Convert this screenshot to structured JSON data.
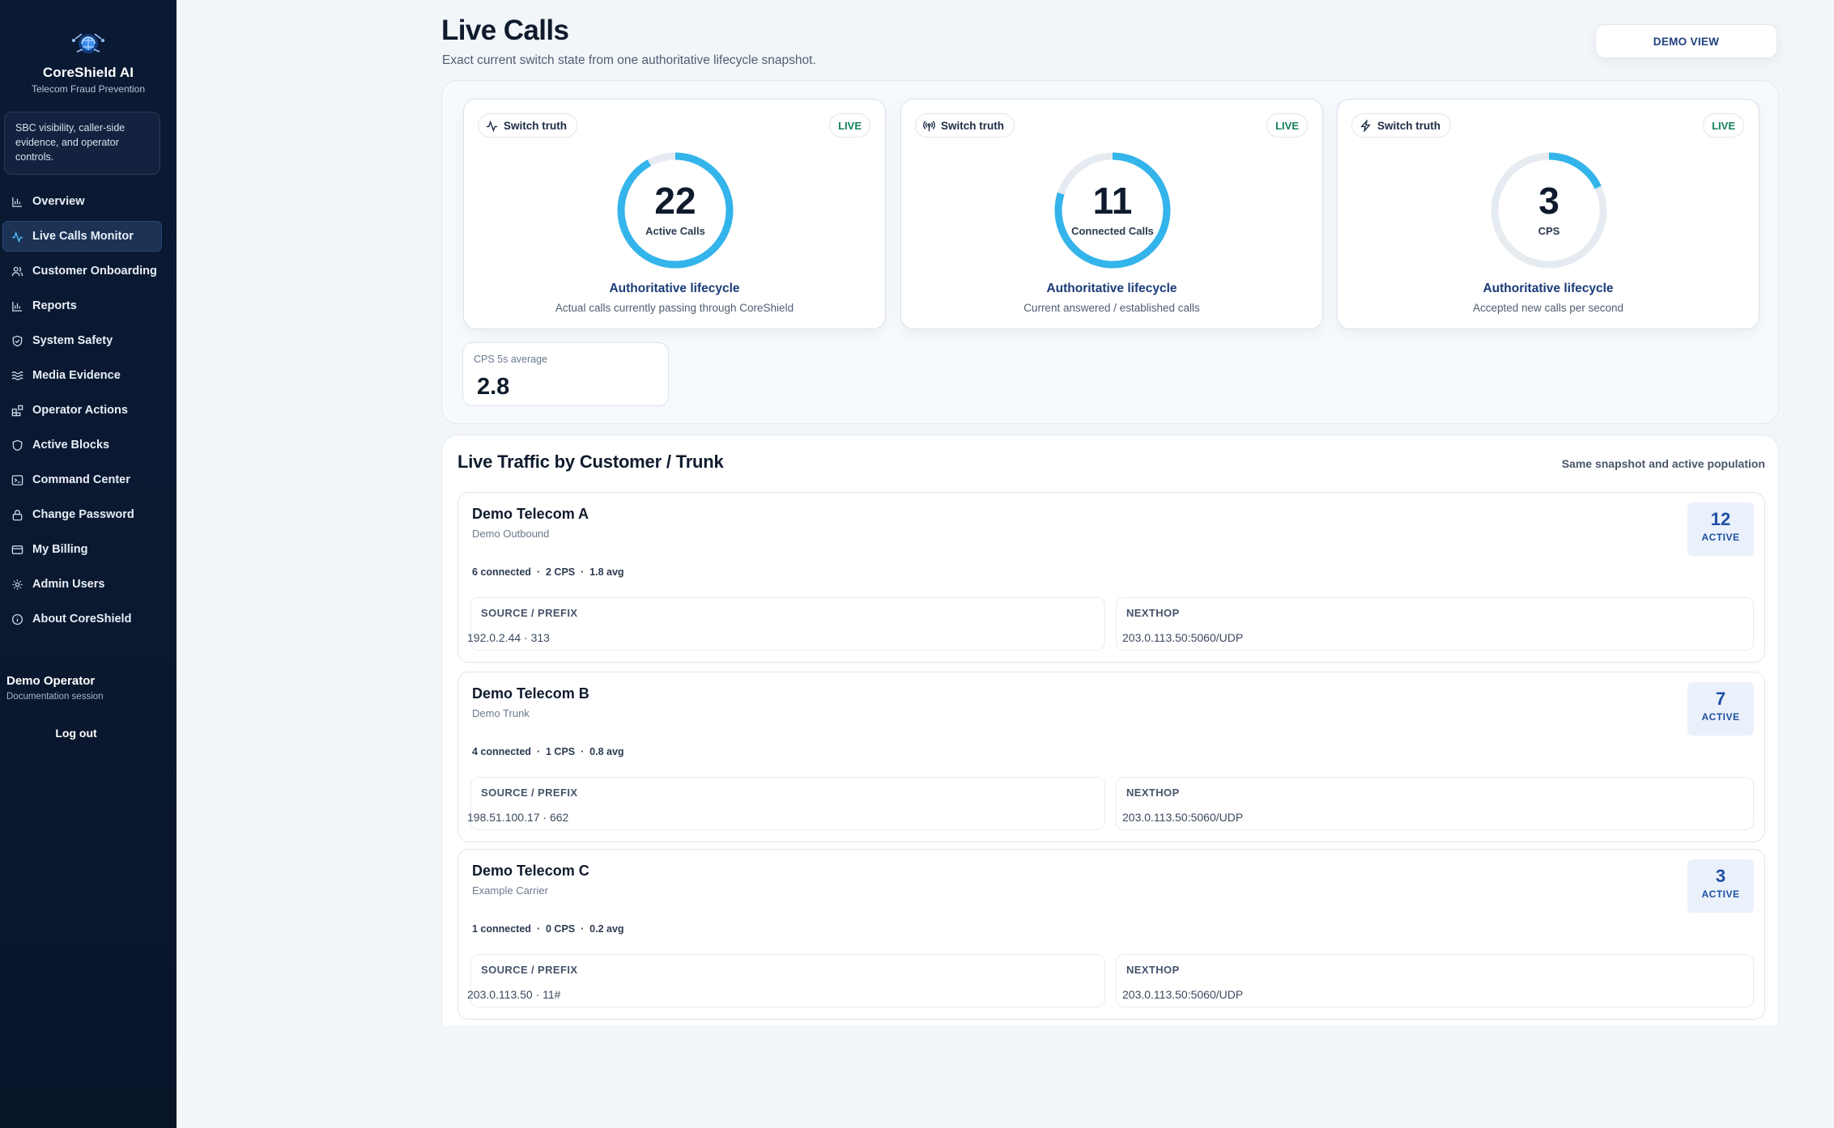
{
  "brand": {
    "name": "CoreShield AI",
    "subtitle": "Telecom Fraud Prevention",
    "tagline": "SBC visibility, caller-side evidence, and operator controls."
  },
  "sidebar": {
    "items": [
      {
        "label": "Overview",
        "icon": "bar-chart-icon"
      },
      {
        "label": "Live Calls Monitor",
        "icon": "activity-icon",
        "active": true
      },
      {
        "label": "Customer Onboarding",
        "icon": "users-icon"
      },
      {
        "label": "Reports",
        "icon": "bar-chart-icon"
      },
      {
        "label": "System Safety",
        "icon": "shield-check-icon"
      },
      {
        "label": "Media Evidence",
        "icon": "waves-icon"
      },
      {
        "label": "Operator Actions",
        "icon": "blocks-icon"
      },
      {
        "label": "Active Blocks",
        "icon": "shield-icon"
      },
      {
        "label": "Command Center",
        "icon": "terminal-icon"
      },
      {
        "label": "Change Password",
        "icon": "lock-icon"
      },
      {
        "label": "My Billing",
        "icon": "card-icon"
      },
      {
        "label": "Admin Users",
        "icon": "gear-icon"
      },
      {
        "label": "About CoreShield",
        "icon": "info-icon"
      }
    ]
  },
  "user": {
    "name": "Demo Operator",
    "role": "Documentation session",
    "logout_label": "Log out"
  },
  "header": {
    "title": "Live Calls",
    "subtitle": "Exact current switch state from one authoritative lifecycle snapshot.",
    "demo_button": "DEMO VIEW"
  },
  "metrics": [
    {
      "chip": "Switch truth",
      "chip_icon": "activity-icon",
      "badge": "LIVE",
      "value": "22",
      "label": "Active Calls",
      "fill": 0.92,
      "title": "Authoritative lifecycle",
      "desc": "Actual calls currently passing through CoreShield"
    },
    {
      "chip": "Switch truth",
      "chip_icon": "antenna-icon",
      "badge": "LIVE",
      "value": "11",
      "label": "Connected Calls",
      "fill": 0.8,
      "title": "Authoritative lifecycle",
      "desc": "Current answered / established calls"
    },
    {
      "chip": "Switch truth",
      "chip_icon": "bolt-icon",
      "badge": "LIVE",
      "value": "3",
      "label": "CPS",
      "fill": 0.18,
      "title": "Authoritative lifecycle",
      "desc": "Accepted new calls per second"
    }
  ],
  "cps_avg": {
    "label": "CPS 5s average",
    "value": "2.8"
  },
  "traffic": {
    "title": "Live Traffic by Customer / Trunk",
    "note": "Same snapshot and active population",
    "source_label": "SOURCE / PREFIX",
    "nexthop_label": "NEXTHOP",
    "active_label": "ACTIVE",
    "trunks": [
      {
        "name": "Demo Telecom A",
        "type": "Demo Outbound",
        "stats": "6 connected  ·  2 CPS  ·  1.8 avg",
        "active": "12",
        "source": "192.0.2.44 · 313",
        "nexthop": "203.0.113.50:5060/UDP"
      },
      {
        "name": "Demo Telecom B",
        "type": "Demo Trunk",
        "stats": "4 connected  ·  1 CPS  ·  0.8 avg",
        "active": "7",
        "source": "198.51.100.17 · 662",
        "nexthop": "203.0.113.50:5060/UDP"
      },
      {
        "name": "Demo Telecom C",
        "type": "Example Carrier",
        "stats": "1 connected  ·  0 CPS  ·  0.2 avg",
        "active": "3",
        "source": "203.0.113.50 · 11#",
        "nexthop": "203.0.113.50:5060/UDP"
      }
    ]
  },
  "colors": {
    "ring": "#33b4ea",
    "ring_track": "#e6ebf1",
    "sidebar_bg": "#0b1a33",
    "accent": "#1e4fa3",
    "live": "#13805f"
  }
}
